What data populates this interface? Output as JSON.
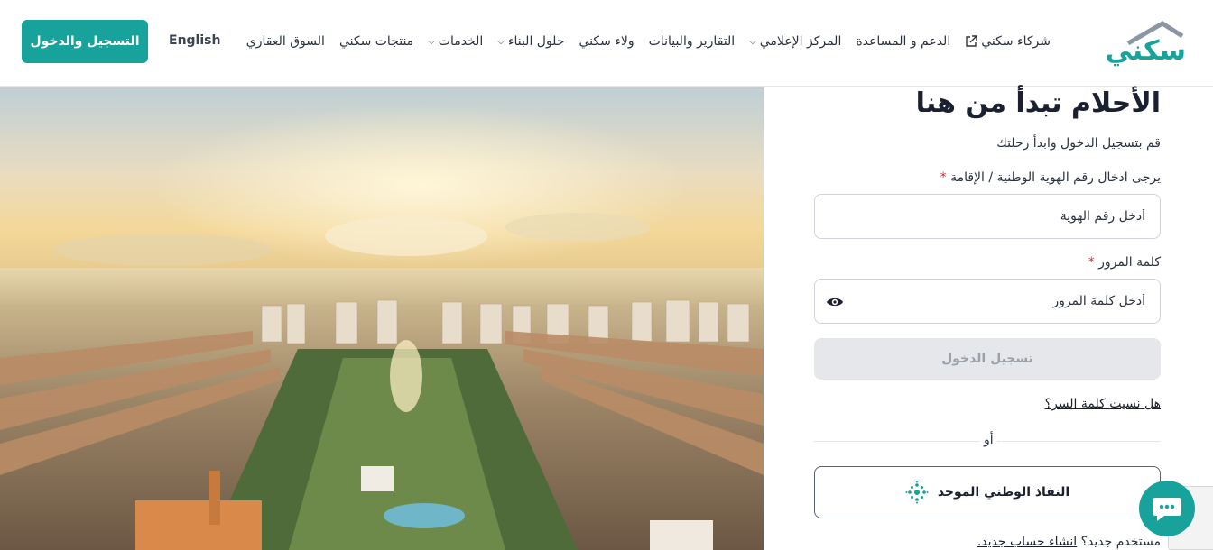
{
  "header": {
    "logo_text": "سكني",
    "nav": [
      {
        "label": "السوق العقاري",
        "dropdown": false
      },
      {
        "label": "منتجات سكني",
        "dropdown": false
      },
      {
        "label": "الخدمات",
        "dropdown": true
      },
      {
        "label": "حلول البناء",
        "dropdown": true
      },
      {
        "label": "ولاء سكني",
        "dropdown": false
      },
      {
        "label": "التقارير والبيانات",
        "dropdown": false
      },
      {
        "label": "المركز الإعلامي",
        "dropdown": true
      },
      {
        "label": "الدعم و المساعدة",
        "dropdown": false
      },
      {
        "label": "شركاء سكني",
        "dropdown": false,
        "external": true
      }
    ],
    "language": "English",
    "login_button": "التسجيل والدخول"
  },
  "form": {
    "title": "الأحلام تبدأ من هنا",
    "subtitle": "قم بتسجيل الدخول وابدأ رحلتك",
    "id_label": "يرجى ادخال رقم الهوية الوطنية / الإقامة",
    "id_placeholder": "أدخل رقم الهوية",
    "password_label": "كلمة المرور",
    "password_placeholder": "أدخل كلمة المرور",
    "required_mark": "*",
    "submit_label": "تسجيل الدخول",
    "forgot_link": "هل نسيت كلمة السر؟",
    "or_text": "أو",
    "nafath_label": "النفاذ الوطني الموحد",
    "new_user_text": "مستخدم جديد؟",
    "create_account_link": "انشاء حساب جديد."
  },
  "colors": {
    "brand": "#17a39b",
    "disabled_button": "#e5e7ea",
    "required": "#d92d3a"
  },
  "icons": [
    "external-link-icon",
    "chevron-down-icon",
    "eye-icon",
    "nafath-icon",
    "chat-icon"
  ]
}
